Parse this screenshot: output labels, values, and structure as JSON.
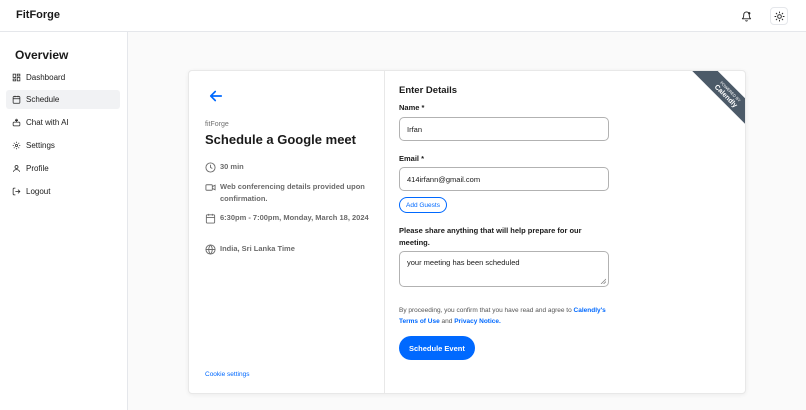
{
  "app": {
    "brand": "FitForge"
  },
  "topbar": {
    "bell_icon": "bell-icon",
    "theme_icon": "sun-icon"
  },
  "sidebar": {
    "title": "Overview",
    "items": [
      {
        "label": "Dashboard",
        "icon": "grid-icon"
      },
      {
        "label": "Schedule",
        "icon": "calendar-icon",
        "active": true
      },
      {
        "label": "Chat with AI",
        "icon": "bot-icon"
      },
      {
        "label": "Settings",
        "icon": "gear-icon"
      },
      {
        "label": "Profile",
        "icon": "user-icon"
      },
      {
        "label": "Logout",
        "icon": "logout-icon"
      }
    ]
  },
  "event": {
    "host": "fitForge",
    "title": "Schedule a Google meet",
    "duration": "30 min",
    "conferencing": "Web conferencing details provided upon confirmation.",
    "datetime": "6:30pm - 7:00pm, Monday, March 18, 2024",
    "timezone": "India, Sri Lanka Time",
    "cookie_settings": "Cookie settings"
  },
  "form": {
    "title": "Enter Details",
    "name_label": "Name *",
    "name_value": "Irfan",
    "email_label": "Email *",
    "email_value": "414irfann@gmail.com",
    "add_guests": "Add Guests",
    "share_label": "Please share anything that will help prepare for our meeting.",
    "share_value": "your meeting has been scheduled",
    "consent_prefix": "By proceeding, you confirm that you have read and agree to",
    "terms_link": "Calendly's Terms of Use",
    "consent_and": "and",
    "privacy_link": "Privacy Notice.",
    "submit": "Schedule Event"
  },
  "ribbon": {
    "powered_by": "POWERED BY",
    "brand": "Calendly"
  },
  "colors": {
    "accent": "#0069ff",
    "ribbon": "#4c5a68",
    "active_nav": "#f1f2f4"
  }
}
